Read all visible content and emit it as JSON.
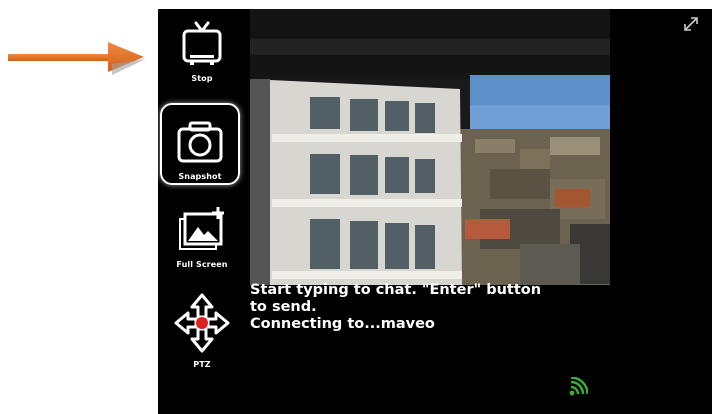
{
  "toolbar": {
    "stop_label": "Stop",
    "snapshot_label": "Snapshot",
    "fullscreen_label": "Full Screen",
    "ptz_label": "PTZ"
  },
  "chat": {
    "line1": "Start typing to chat. \"Enter\" button",
    "line2": "to send.",
    "status": "Connecting to...maveo"
  },
  "icons": {
    "pointer": "arrow-right-icon",
    "stop": "tv-icon",
    "snapshot": "camera-icon",
    "fullscreen": "image-plus-icon",
    "ptz": "move-arrows-icon",
    "expand": "expand-icon",
    "signal": "wifi-signal-icon"
  },
  "colors": {
    "accent_arrow": "#e8722a",
    "viewer_background": "#000000",
    "signal_green": "#3ab03a",
    "ptz_center": "#e02020"
  }
}
